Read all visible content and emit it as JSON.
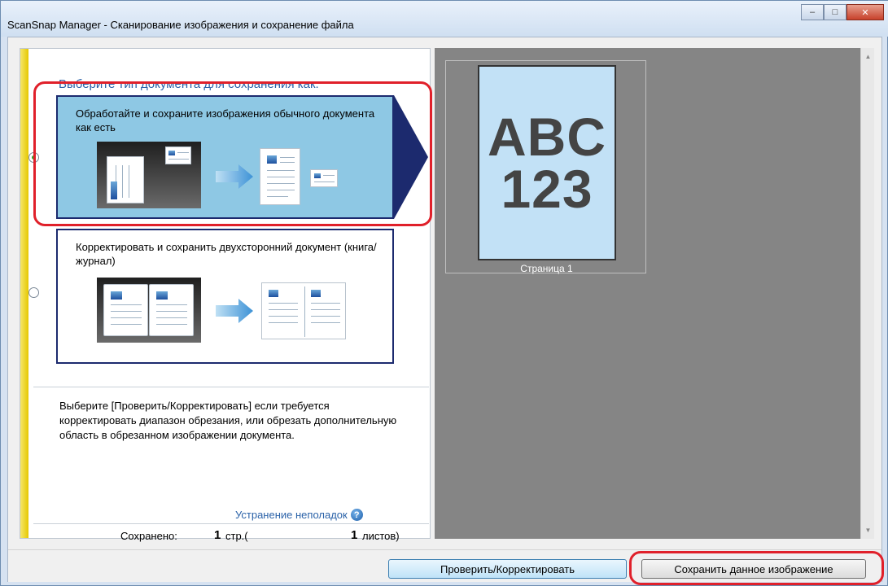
{
  "window": {
    "title": "ScanSnap Manager - Сканирование изображения и сохранение файла",
    "controls": {
      "minimize": "–",
      "maximize": "□",
      "close": "✕"
    }
  },
  "left_panel": {
    "heading": "Выберите тип документа для сохранения как.",
    "options": [
      {
        "label": "Обработайте и сохраните изображения обычного документа как есть",
        "selected": true
      },
      {
        "label": "Корректировать  и сохранить двухсторонний документ  (книга/журнал)",
        "selected": false
      }
    ],
    "info": "Выберите [Проверить/Корректировать] если требуется корректировать диапазон обрезания, или обрезать дополнительную область в обрезанном изображении документа.",
    "troubleshoot_link": "Устранение неполадок",
    "help_icon": "?",
    "saved": {
      "label": "Сохранено:",
      "pages_value": "1",
      "pages_unit": "стр.(",
      "sheets_value": "1",
      "sheets_unit": "листов)"
    }
  },
  "preview": {
    "thumbnail_line1": "ABC",
    "thumbnail_line2": "123",
    "thumbnail_caption": "Страница 1"
  },
  "buttons": {
    "verify": "Проверить/Корректировать",
    "save": "Сохранить данное изображение"
  },
  "colors": {
    "accent_blue": "#2b62a8",
    "selected_option_bg": "#8ec8e4",
    "option_border": "#1c2a6e",
    "highlight_red": "#e0202a",
    "preview_bg": "#858585"
  }
}
